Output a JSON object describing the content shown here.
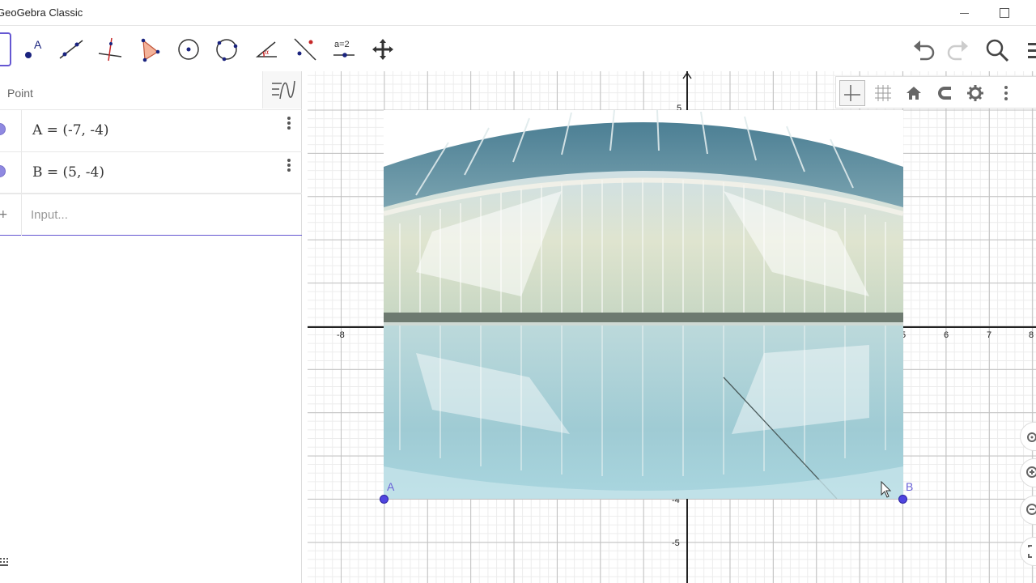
{
  "window": {
    "title": "GeoGebra Classic"
  },
  "toolbar": {
    "tools": [
      {
        "name": "move-tool",
        "icon": "arrow-icon"
      },
      {
        "name": "point-tool",
        "icon": "point-icon"
      },
      {
        "name": "line-tool",
        "icon": "line-icon"
      },
      {
        "name": "perpendicular-tool",
        "icon": "perpendicular-icon"
      },
      {
        "name": "polygon-tool",
        "icon": "polygon-icon"
      },
      {
        "name": "circle-center-tool",
        "icon": "circle-center-icon"
      },
      {
        "name": "circle-three-points-tool",
        "icon": "circle-three-points-icon"
      },
      {
        "name": "angle-tool",
        "icon": "angle-icon"
      },
      {
        "name": "reflect-tool",
        "icon": "reflect-icon"
      },
      {
        "name": "slider-tool",
        "icon": "slider-icon",
        "text": "a=2"
      },
      {
        "name": "move-graphics-tool",
        "icon": "move-graphics-icon"
      }
    ],
    "right": [
      "undo-icon",
      "redo-icon",
      "search-icon",
      "menu-icon"
    ]
  },
  "algebra": {
    "header_label": "Point",
    "items": [
      {
        "expr": "A = (-7, -4)"
      },
      {
        "expr": "B = (5, -4)"
      }
    ],
    "input_placeholder": "Input..."
  },
  "graphics": {
    "x_ticks": [
      "-8",
      "5",
      "6",
      "7",
      "8"
    ],
    "y_ticks": [
      "5",
      "-4",
      "-5"
    ],
    "points": [
      {
        "label": "A",
        "x": -7,
        "y": -4
      },
      {
        "label": "B",
        "x": 5,
        "y": -4
      }
    ],
    "style_bar": [
      "axes-icon",
      "grid-icon",
      "home-icon",
      "magnet-icon",
      "gear-icon",
      "more-icon"
    ],
    "zoom_controls": [
      "fullscreen-icon",
      "zoom-in-icon",
      "zoom-out-icon",
      "zoom-fit-icon"
    ]
  },
  "colors": {
    "accent": "#6557d2",
    "point_fill": "#4f45e0",
    "point_label": "#6a62d8"
  }
}
